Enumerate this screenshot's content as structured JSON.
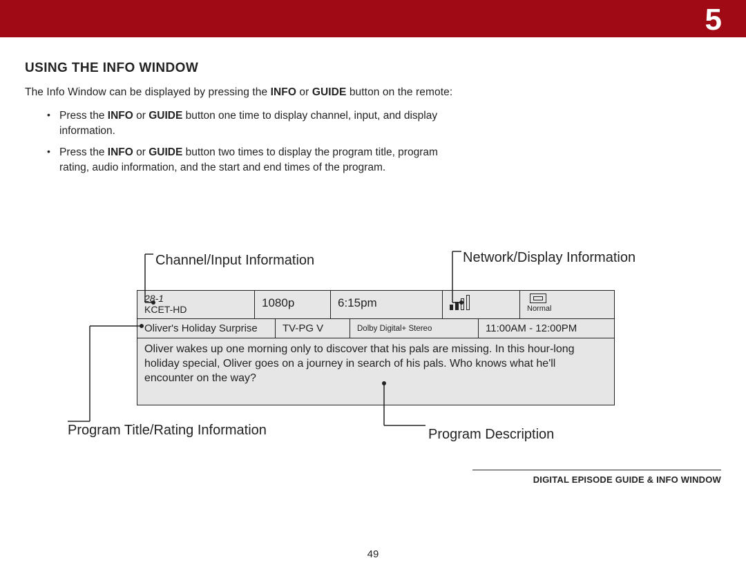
{
  "chapter_number": "5",
  "section_title": "USING THE INFO WINDOW",
  "intro_pre": "The Info Window can be displayed by pressing the ",
  "intro_b1": "INFO",
  "intro_mid1": " or ",
  "intro_b2": "GUIDE",
  "intro_post": " button on the remote:",
  "bullet1_pre": "Press the ",
  "bullet1_b1": "INFO",
  "bullet1_mid": " or ",
  "bullet1_b2": "GUIDE",
  "bullet1_post": " button one time to display channel, input, and display information.",
  "bullet2_pre": "Press the ",
  "bullet2_b1": "INFO",
  "bullet2_mid": " or ",
  "bullet2_b2": "GUIDE",
  "bullet2_post": " button two times to display the program title, program rating, audio information, and the start and end times of the program.",
  "labels": {
    "channel_input": "Channel/Input Information",
    "network_display": "Network/Display Information",
    "program_title": "Program Title/Rating Information",
    "program_desc": "Program Description"
  },
  "info": {
    "channel_num": "28-1",
    "channel_name": "KCET-HD",
    "resolution": "1080p",
    "clock": "6:15pm",
    "display_mode": "Normal",
    "program_title": "Oliver's Holiday Surprise",
    "rating": "TV-PG V",
    "audio": "Dolby Digital+ Stereo",
    "time_range": "11:00AM - 12:00PM",
    "description": "Oliver wakes up one morning only to discover that his pals are missing. In this hour-long holiday special, Oliver goes on a journey in search of his pals. Who knows what he'll encounter on the way?"
  },
  "footer": "DIGITAL EPISODE GUIDE & INFO WINDOW",
  "page_number": "49"
}
